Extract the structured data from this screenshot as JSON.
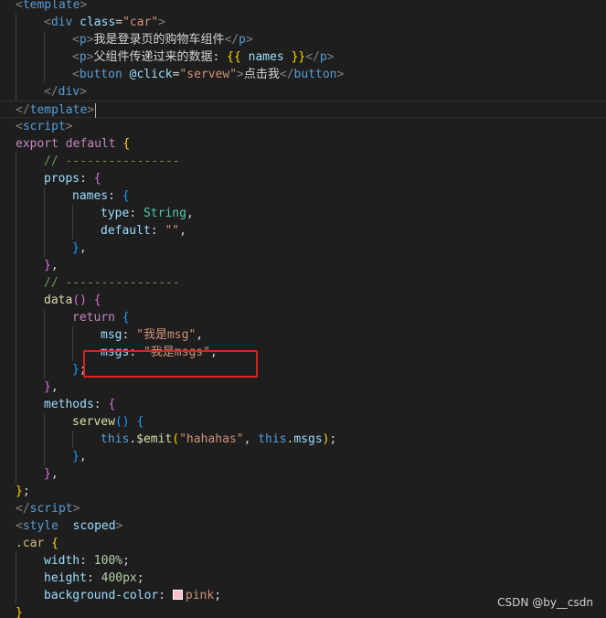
{
  "editor": {
    "lines": [
      {
        "indent": 0,
        "active": false,
        "tokens": [
          [
            "punc",
            "<"
          ],
          [
            "tag",
            "template"
          ],
          [
            "punc",
            ">"
          ]
        ]
      },
      {
        "indent": 1,
        "active": false,
        "tokens": [
          [
            "punc",
            "<"
          ],
          [
            "tag",
            "div"
          ],
          [
            "text",
            " "
          ],
          [
            "attr",
            "class"
          ],
          [
            "text",
            "="
          ],
          [
            "str",
            "\"car\""
          ],
          [
            "punc",
            ">"
          ]
        ]
      },
      {
        "indent": 2,
        "active": false,
        "tokens": [
          [
            "punc",
            "<"
          ],
          [
            "tag",
            "p"
          ],
          [
            "punc",
            ">"
          ],
          [
            "text",
            "我是登录页的购物车组件"
          ],
          [
            "punc",
            "</"
          ],
          [
            "tag",
            "p"
          ],
          [
            "punc",
            ">"
          ]
        ]
      },
      {
        "indent": 2,
        "active": false,
        "tokens": [
          [
            "punc",
            "<"
          ],
          [
            "tag",
            "p"
          ],
          [
            "punc",
            ">"
          ],
          [
            "text",
            "父组件传递过来的数据: "
          ],
          [
            "brace",
            "{{"
          ],
          [
            "text",
            " "
          ],
          [
            "var",
            "names"
          ],
          [
            "text",
            " "
          ],
          [
            "brace",
            "}}"
          ],
          [
            "punc",
            "</"
          ],
          [
            "tag",
            "p"
          ],
          [
            "punc",
            ">"
          ]
        ]
      },
      {
        "indent": 2,
        "active": false,
        "tokens": [
          [
            "punc",
            "<"
          ],
          [
            "tag",
            "button"
          ],
          [
            "text",
            " "
          ],
          [
            "attr",
            "@click"
          ],
          [
            "text",
            "="
          ],
          [
            "str",
            "\"servew\""
          ],
          [
            "punc",
            ">"
          ],
          [
            "text",
            "点击我"
          ],
          [
            "punc",
            "</"
          ],
          [
            "tag",
            "button"
          ],
          [
            "punc",
            ">"
          ]
        ]
      },
      {
        "indent": 1,
        "active": false,
        "tokens": [
          [
            "punc",
            "</"
          ],
          [
            "tag",
            "div"
          ],
          [
            "punc",
            ">"
          ]
        ]
      },
      {
        "indent": 0,
        "active": true,
        "cursor": true,
        "tokens": [
          [
            "punc",
            "</"
          ],
          [
            "tag",
            "template"
          ],
          [
            "punc",
            ">"
          ]
        ]
      },
      {
        "indent": 0,
        "active": false,
        "tokens": [
          [
            "punc",
            "<"
          ],
          [
            "tag",
            "script"
          ],
          [
            "punc",
            ">"
          ]
        ]
      },
      {
        "indent": 0,
        "active": false,
        "tokens": [
          [
            "kw",
            "export"
          ],
          [
            "text",
            " "
          ],
          [
            "kw",
            "default"
          ],
          [
            "text",
            " "
          ],
          [
            "brace",
            "{"
          ]
        ]
      },
      {
        "indent": 1,
        "active": false,
        "tokens": [
          [
            "comment",
            "// ----------------"
          ]
        ]
      },
      {
        "indent": 1,
        "active": false,
        "tokens": [
          [
            "prop",
            "props"
          ],
          [
            "text",
            ": "
          ],
          [
            "brace2",
            "{"
          ]
        ]
      },
      {
        "indent": 2,
        "active": false,
        "tokens": [
          [
            "prop",
            "names"
          ],
          [
            "text",
            ": "
          ],
          [
            "brace3",
            "{"
          ]
        ]
      },
      {
        "indent": 3,
        "active": false,
        "tokens": [
          [
            "prop",
            "type"
          ],
          [
            "text",
            ": "
          ],
          [
            "type",
            "String"
          ],
          [
            "text",
            ","
          ]
        ]
      },
      {
        "indent": 3,
        "active": false,
        "tokens": [
          [
            "prop",
            "default"
          ],
          [
            "text",
            ": "
          ],
          [
            "str",
            "\"\""
          ],
          [
            "text",
            ","
          ]
        ]
      },
      {
        "indent": 2,
        "active": false,
        "tokens": [
          [
            "brace3",
            "}"
          ],
          [
            "text",
            ","
          ]
        ]
      },
      {
        "indent": 1,
        "active": false,
        "tokens": [
          [
            "brace2",
            "}"
          ],
          [
            "text",
            ","
          ]
        ]
      },
      {
        "indent": 1,
        "active": false,
        "tokens": [
          [
            "comment",
            "// ----------------"
          ]
        ]
      },
      {
        "indent": 1,
        "active": false,
        "tokens": [
          [
            "fn",
            "data"
          ],
          [
            "brace2",
            "()"
          ],
          [
            "text",
            " "
          ],
          [
            "brace2",
            "{"
          ]
        ]
      },
      {
        "indent": 2,
        "active": false,
        "tokens": [
          [
            "kw",
            "return"
          ],
          [
            "text",
            " "
          ],
          [
            "brace3",
            "{"
          ]
        ]
      },
      {
        "indent": 3,
        "active": false,
        "tokens": [
          [
            "prop",
            "msg"
          ],
          [
            "text",
            ": "
          ],
          [
            "str",
            "\"我是msg\""
          ],
          [
            "text",
            ","
          ]
        ]
      },
      {
        "indent": 3,
        "active": false,
        "tokens": [
          [
            "prop",
            "msgs"
          ],
          [
            "text",
            ": "
          ],
          [
            "str",
            "\"我是msgs\""
          ],
          [
            "text",
            ","
          ]
        ]
      },
      {
        "indent": 2,
        "active": false,
        "tokens": [
          [
            "brace3",
            "}"
          ],
          [
            "text",
            ";"
          ]
        ]
      },
      {
        "indent": 1,
        "active": false,
        "tokens": [
          [
            "brace2",
            "}"
          ],
          [
            "text",
            ","
          ]
        ]
      },
      {
        "indent": 1,
        "active": false,
        "tokens": [
          [
            "prop",
            "methods"
          ],
          [
            "text",
            ": "
          ],
          [
            "brace2",
            "{"
          ]
        ]
      },
      {
        "indent": 2,
        "active": false,
        "tokens": [
          [
            "fn",
            "servew"
          ],
          [
            "brace3",
            "()"
          ],
          [
            "text",
            " "
          ],
          [
            "brace3",
            "{"
          ]
        ]
      },
      {
        "indent": 3,
        "active": false,
        "tokens": [
          [
            "this",
            "this"
          ],
          [
            "text",
            "."
          ],
          [
            "fn",
            "$emit"
          ],
          [
            "brace",
            "("
          ],
          [
            "str",
            "\"hahahas\""
          ],
          [
            "text",
            ", "
          ],
          [
            "this",
            "this"
          ],
          [
            "text",
            "."
          ],
          [
            "prop",
            "msgs"
          ],
          [
            "brace",
            ")"
          ],
          [
            "text",
            ";"
          ]
        ]
      },
      {
        "indent": 2,
        "active": false,
        "tokens": [
          [
            "brace3",
            "}"
          ],
          [
            "text",
            ","
          ]
        ]
      },
      {
        "indent": 1,
        "active": false,
        "tokens": [
          [
            "brace2",
            "}"
          ],
          [
            "text",
            ","
          ]
        ]
      },
      {
        "indent": 0,
        "active": false,
        "tokens": [
          [
            "brace",
            "}"
          ],
          [
            "text",
            ";"
          ]
        ]
      },
      {
        "indent": 0,
        "active": false,
        "tokens": [
          [
            "punc",
            "</"
          ],
          [
            "tag",
            "script"
          ],
          [
            "punc",
            ">"
          ]
        ]
      },
      {
        "indent": 0,
        "active": false,
        "tokens": [
          [
            "punc",
            "<"
          ],
          [
            "tag",
            "style"
          ],
          [
            "text",
            "  "
          ],
          [
            "attr",
            "scoped"
          ],
          [
            "punc",
            ">"
          ]
        ]
      },
      {
        "indent": 0,
        "active": false,
        "tokens": [
          [
            "sel",
            ".car"
          ],
          [
            "text",
            " "
          ],
          [
            "brace",
            "{"
          ]
        ]
      },
      {
        "indent": 1,
        "active": false,
        "tokens": [
          [
            "cssprop",
            "width"
          ],
          [
            "text",
            ": "
          ],
          [
            "num",
            "100%"
          ],
          [
            "text",
            ";"
          ]
        ]
      },
      {
        "indent": 1,
        "active": false,
        "tokens": [
          [
            "cssprop",
            "height"
          ],
          [
            "text",
            ": "
          ],
          [
            "num",
            "400px"
          ],
          [
            "text",
            ";"
          ]
        ]
      },
      {
        "indent": 1,
        "active": false,
        "tokens": [
          [
            "cssprop",
            "background-color"
          ],
          [
            "text",
            ": "
          ],
          [
            "swatch",
            "#ffc0cb"
          ],
          [
            "str",
            "pink"
          ],
          [
            "text",
            ";"
          ]
        ]
      },
      {
        "indent": 0,
        "active": false,
        "tokens": [
          [
            "brace",
            "}"
          ]
        ]
      }
    ]
  },
  "watermark": "CSDN @by__csdn"
}
